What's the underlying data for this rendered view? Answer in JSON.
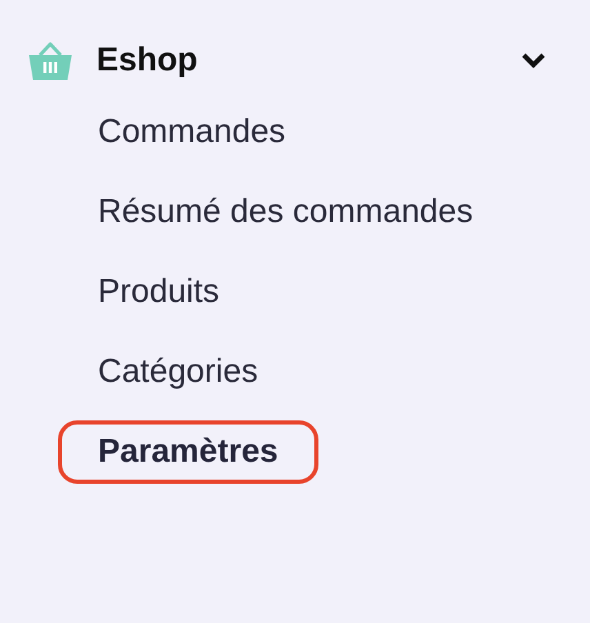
{
  "menu": {
    "title": "Eshop",
    "expanded": true,
    "items": [
      {
        "label": "Commandes",
        "selected": false
      },
      {
        "label": "Résumé des commandes",
        "selected": false
      },
      {
        "label": "Produits",
        "selected": false
      },
      {
        "label": "Catégories",
        "selected": false
      },
      {
        "label": "Paramètres",
        "selected": true
      }
    ]
  }
}
